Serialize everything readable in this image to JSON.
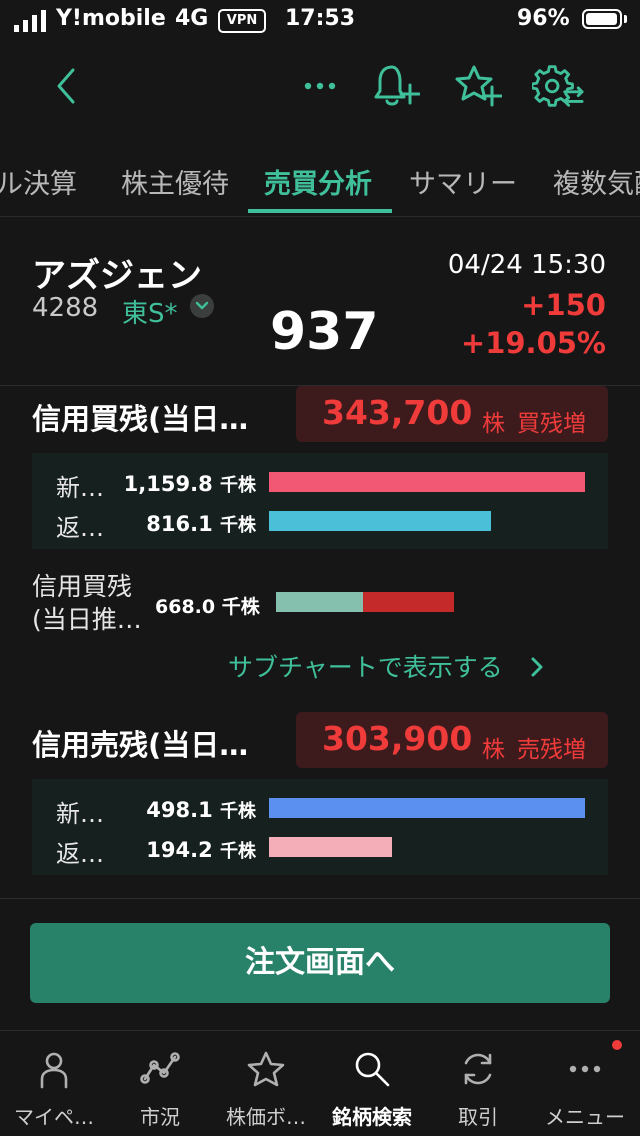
{
  "status_bar": {
    "carrier": "Y!mobile",
    "network": "4G",
    "vpn": "VPN",
    "time": "17:53",
    "battery": "96%",
    "battery_level": 0.96
  },
  "tabs": [
    "ル決算",
    "株主優待",
    "売買分析",
    "サマリー",
    "複数気配"
  ],
  "active_tab": "売買分析",
  "stock": {
    "name": "アズジェン",
    "code": "4288",
    "market": "東S*",
    "price": "937",
    "datetime": "04/24 15:30",
    "change": "+150",
    "change_pct": "+19.05%"
  },
  "margin_buy": {
    "title": "信用買残(当日…",
    "balance": "343,700",
    "unit": "株",
    "status": "買残増",
    "rows": [
      {
        "label": "新…",
        "value": "1,159.8",
        "unit": "千株",
        "color": "#f25774",
        "level": 1.0
      },
      {
        "label": "返…",
        "value": "816.1",
        "unit": "千株",
        "color": "#4bbfd8",
        "level": 0.704
      }
    ],
    "sub": {
      "label_line1": "信用買残",
      "label_line2": "(当日推…",
      "value": "668.0",
      "unit": "千株",
      "colors": [
        "#84c0ad",
        "#c42a2a"
      ],
      "split": 0.486
    },
    "link": "サブチャートで表示する"
  },
  "margin_sell": {
    "title": "信用売残(当日…",
    "balance": "303,900",
    "unit": "株",
    "status": "売残増",
    "rows": [
      {
        "label": "新…",
        "value": "498.1",
        "unit": "千株",
        "color": "#5b8ff0",
        "level": 1.0
      },
      {
        "label": "返…",
        "value": "194.2",
        "unit": "千株",
        "color": "#f4aeb8",
        "level": 0.39
      }
    ]
  },
  "order_button": "注文画面へ",
  "bottom_nav": [
    {
      "label": "マイペ…",
      "icon": "person-icon"
    },
    {
      "label": "市況",
      "icon": "trend-icon"
    },
    {
      "label": "株価ボ…",
      "icon": "star-icon"
    },
    {
      "label": "銘柄検索",
      "icon": "search-icon",
      "active": true
    },
    {
      "label": "取引",
      "icon": "refresh-icon"
    },
    {
      "label": "メニュー",
      "icon": "more-icon"
    }
  ],
  "colors": {
    "accent": "#3fbf9a",
    "up": "#f03b3b",
    "background": "#161616"
  }
}
